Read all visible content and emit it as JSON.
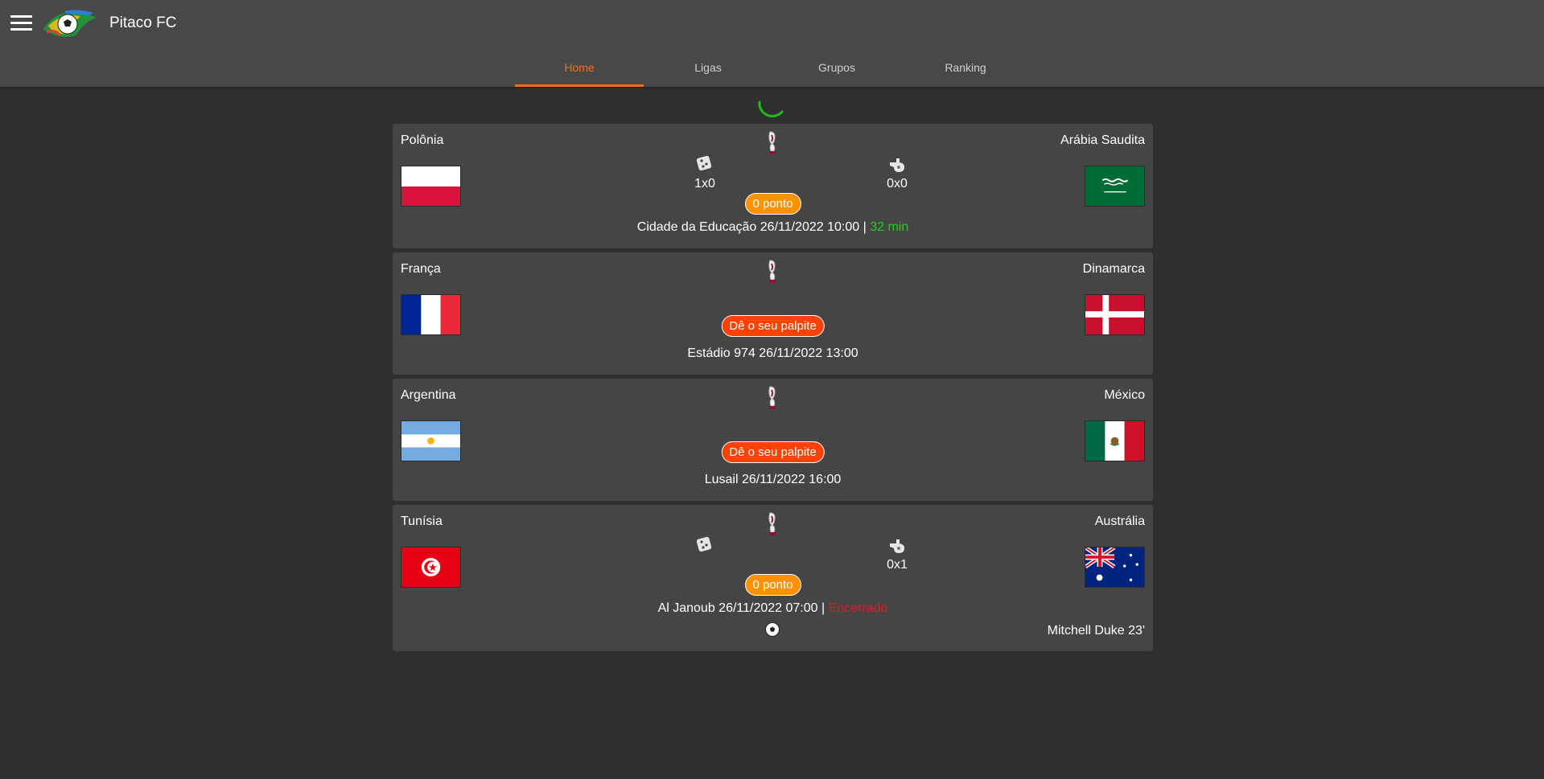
{
  "app": {
    "title": "Pitaco FC"
  },
  "tabs": [
    {
      "label": "Home",
      "active": true
    },
    {
      "label": "Ligas",
      "active": false
    },
    {
      "label": "Grupos",
      "active": false
    },
    {
      "label": "Ranking",
      "active": false
    }
  ],
  "matches": [
    {
      "home": "Polônia",
      "away": "Arábia Saudita",
      "home_flag": "poland-flag",
      "away_flag": "saudi-arabia-flag",
      "guess_score": "1x0",
      "actual_score": "0x0",
      "badge": "0 ponto",
      "venue_time": "Cidade da Educação 26/11/2022 10:00",
      "separator": "|",
      "status": "32 min"
    },
    {
      "home": "França",
      "away": "Dinamarca",
      "home_flag": "france-flag",
      "away_flag": "denmark-flag",
      "badge": "Dê o seu palpite",
      "venue_time": "Estádio 974 26/11/2022 13:00"
    },
    {
      "home": "Argentina",
      "away": "México",
      "home_flag": "argentina-flag",
      "away_flag": "mexico-flag",
      "badge": "Dê o seu palpite",
      "venue_time": "Lusail 26/11/2022 16:00"
    },
    {
      "home": "Tunísia",
      "away": "Austrália",
      "home_flag": "tunisia-flag",
      "away_flag": "australia-flag",
      "guess_score": "",
      "actual_score": "0x1",
      "badge": "0 ponto",
      "venue_time": "Al Janoub 26/11/2022 07:00",
      "separator": "|",
      "status": "Encerrado",
      "scorer": "Mitchell Duke 23'"
    }
  ],
  "colors": {
    "accent": "#ff6d1a",
    "points_badge": "#ff9200",
    "palpite_badge": "#ff4200",
    "live": "#21d11c",
    "ended": "#e21c1c",
    "card_bg": "#454545",
    "page_bg": "#2f2f2f"
  }
}
